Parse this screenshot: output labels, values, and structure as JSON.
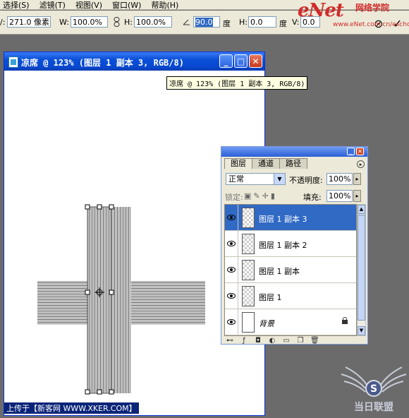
{
  "menu": [
    "选择(S)",
    "滤镜(T)",
    "视图(V)",
    "窗口(W)",
    "帮助(H)"
  ],
  "options": {
    "x_value": "271.0 像素",
    "w_label": "W:",
    "w_value": "100.0%",
    "h_label": "H:",
    "h_value": "100.0%",
    "angle_value": "90.0",
    "angle_unit": "度",
    "skew_h_label": "H:",
    "skew_h_value": "0.0",
    "skew_unit": "度",
    "skew_v_label": "V:",
    "skew_v_value": "0.0"
  },
  "logo": {
    "main": "eNet",
    "sub": "网络学院",
    "url": "www.eNet.com.cn/eschool"
  },
  "document": {
    "title": "凉席 @ 123% (图层 1 副本 3, RGB/8)",
    "tooltip": "凉席 @ 123% (图层 1 副本 3, RGB/8)"
  },
  "layers_panel": {
    "tabs": [
      "图层",
      "通道",
      "路径"
    ],
    "blend_mode": "正常",
    "opacity_label": "不透明度:",
    "opacity_value": "100%",
    "lock_label": "锁定:",
    "fill_label": "填充:",
    "fill_value": "100%",
    "layers": [
      {
        "name": "图层 1 副本 3",
        "selected": true
      },
      {
        "name": "图层 1 副本 2",
        "selected": false
      },
      {
        "name": "图层 1 副本",
        "selected": false
      },
      {
        "name": "图层 1",
        "selected": false
      },
      {
        "name": "背景",
        "selected": false,
        "locked": true
      }
    ]
  },
  "watermark": {
    "left": "上传于【新客网 WWW.XKER.COM】",
    "right": "当日联盟"
  },
  "colors": {
    "selection": "#316ac5",
    "titlebar": "#0a4fd8",
    "workspace": "#6b6b6b"
  }
}
